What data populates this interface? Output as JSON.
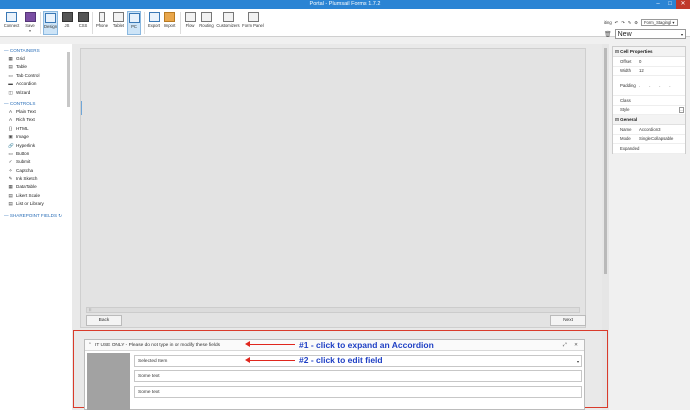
{
  "window": {
    "title": "Portal - Plumsail Forms 1.7.2",
    "min": "–",
    "max": "□",
    "close": "✕"
  },
  "ribbon": {
    "buttons": [
      {
        "label": "Connect"
      },
      {
        "label": "Save",
        "sub": "▾"
      },
      {
        "label": "Design"
      },
      {
        "label": "JS"
      },
      {
        "label": "CSS"
      },
      {
        "label": "Phone"
      },
      {
        "label": "Tablet"
      },
      {
        "label": "PC"
      },
      {
        "label": "Export"
      },
      {
        "label": "Import"
      },
      {
        "label": "Flow"
      },
      {
        "label": "Routing"
      },
      {
        "label": "Customizers"
      },
      {
        "label": "Form Panel"
      }
    ],
    "editing": "iting",
    "undo": "↶",
    "redo": "↷",
    "edit": "✎",
    "settings": "⚙",
    "stage": "Form_Stagingl",
    "stage_arrow": "▾",
    "trash": "🗑",
    "form_select": "New",
    "form_arrow": "▾"
  },
  "sidebar": {
    "containers_title": "CONTAINERS",
    "containers": [
      "Grid",
      "Table",
      "Tab Control",
      "Accordion",
      "Wizard"
    ],
    "container_glyphs": [
      "▦",
      "▤",
      "▭",
      "▬",
      "◫"
    ],
    "controls_title": "CONTROLS",
    "controls": [
      "Plain Text",
      "Rich Text",
      "HTML",
      "Image",
      "Hyperlink",
      "Button",
      "Submit",
      "Captcha",
      "Ink Sketch",
      "DataTable",
      "Likert Scale",
      "List or Library"
    ],
    "control_glyphs": [
      "A",
      "A",
      "{}",
      "▣",
      "🔗",
      "▭",
      "✓",
      "✧",
      "✎",
      "▦",
      "▤",
      "▤"
    ],
    "sharepoint_title": "SHAREPOINT FIELDS",
    "refresh": "↻",
    "section_toggle": "—"
  },
  "canvas": {
    "back_label": "Back",
    "next_label": "Next",
    "hscroll_glyph": "⁝⁝"
  },
  "properties": {
    "cell_title": "Cell Properties",
    "offset_label": "Offset",
    "offset_value": "0",
    "width_label": "Width",
    "width_value": "12",
    "padding_label": "Padding",
    "padding_marks": "- - - -",
    "class_label": "Class",
    "style_label": "Style",
    "style_btn": "…",
    "general_title": "General",
    "name_label": "Name",
    "name_value": "Accordion3",
    "mode_label": "Mode",
    "mode_value": "SingleCollapsable",
    "expanded_label": "Expanded",
    "toggle": "⊟"
  },
  "accordion": {
    "chevron": "⌃",
    "title": "IT USE ONLY - Please do not type in or modify these fields",
    "tools": "⤢ ✕",
    "field1": "Selected Item",
    "field1_arrow": "▾",
    "field2": "Some text",
    "field3": "Some text"
  },
  "annotations": {
    "a1": "#1 - click to expand an Accordion",
    "a2": "#2 - click to edit field"
  },
  "colors": {
    "accent": "#2b84d4",
    "highlight": "#d93b2b",
    "annotation": "#1e3fc4"
  }
}
